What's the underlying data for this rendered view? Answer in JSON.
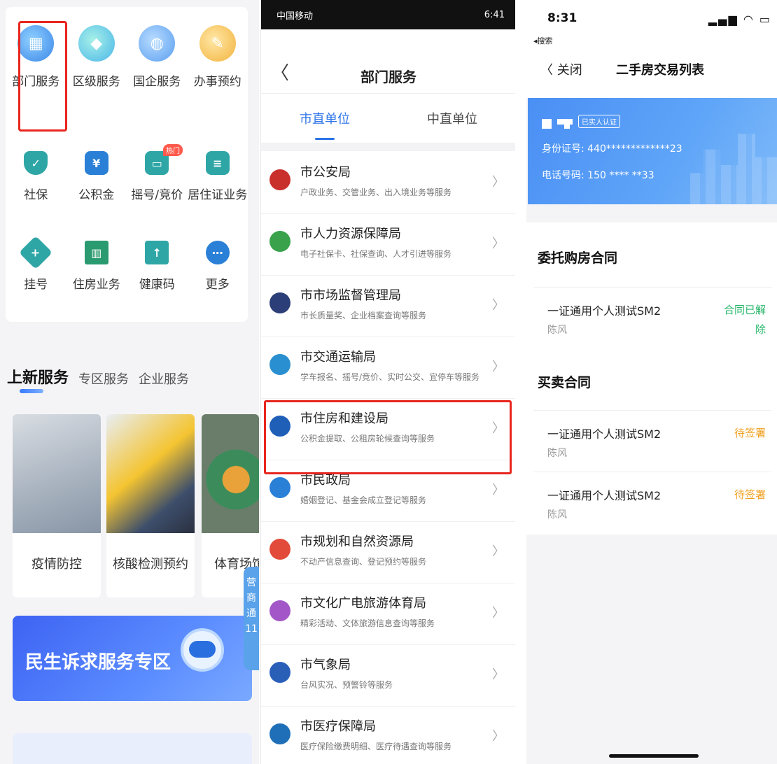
{
  "panel1": {
    "top_grid": [
      {
        "label": "部门服务",
        "icon": "department-icon",
        "color": "#3b86e8"
      },
      {
        "label": "区级服务",
        "icon": "district-icon",
        "color": "#4bb6e8"
      },
      {
        "label": "国企服务",
        "icon": "enterprise-icon",
        "color": "#5a9ef0"
      },
      {
        "label": "办事预约",
        "icon": "appointment-icon",
        "color": "#f2b33d"
      }
    ],
    "mid_grid": [
      {
        "label": "社保",
        "icon": "shield-icon",
        "color": "#2fa6a6"
      },
      {
        "label": "公积金",
        "icon": "house-yen-icon",
        "color": "#2a7fd6"
      },
      {
        "label": "摇号/竞价",
        "icon": "car-icon",
        "color": "#2fa6a6",
        "badge": "热门"
      },
      {
        "label": "居住证业务",
        "icon": "id-card-icon",
        "color": "#2fa6a6"
      }
    ],
    "low_grid": [
      {
        "label": "挂号",
        "icon": "plus-diamond-icon",
        "color": "#2fa6a6"
      },
      {
        "label": "住房业务",
        "icon": "building-icon",
        "color": "#2a9a70"
      },
      {
        "label": "健康码",
        "icon": "health-code-icon",
        "color": "#2fa6a6"
      },
      {
        "label": "更多",
        "icon": "more-icon",
        "color": "#2a7fd6"
      }
    ],
    "tabs": [
      "上新服务",
      "专区服务",
      "企业服务"
    ],
    "services": [
      "疫情防控",
      "核酸检测预约",
      "体育场馆预"
    ],
    "banner_text": "民生诉求服务专区",
    "float_text": "营商通11"
  },
  "panel2": {
    "status_left": "中国移动",
    "status_right": "6:41",
    "title": "部门服务",
    "seg_tabs": [
      "市直单位",
      "中直单位"
    ],
    "departments": [
      {
        "name": "市公安局",
        "desc": "户政业务、交管业务、出入境业务等服务",
        "color": "#c9302c",
        "icon": "police-badge-icon"
      },
      {
        "name": "市人力资源保障局",
        "desc": "电子社保卡、社保查询、人才引进等服务",
        "color": "#3aa24a",
        "icon": "hr-icon"
      },
      {
        "name": "市市场监督管理局",
        "desc": "市长质量奖、企业档案查询等服务",
        "color": "#2c3e78",
        "icon": "market-icon"
      },
      {
        "name": "市交通运输局",
        "desc": "学车报名、摇号/竞价、实时公交、宜停车等服务",
        "color": "#2a8fd0",
        "icon": "transport-icon"
      },
      {
        "name": "市住房和建设局",
        "desc": "公积金提取、公租房轮候查询等服务",
        "color": "#1f5fb8",
        "icon": "szjs-logo-icon"
      },
      {
        "name": "市民政局",
        "desc": "婚姻登记、基金会成立登记等服务",
        "color": "#2a7fd6",
        "icon": "civil-affairs-icon"
      },
      {
        "name": "市规划和自然资源局",
        "desc": "不动产信息查询、登记预约等服务",
        "color": "#e24a3a",
        "icon": "planning-icon"
      },
      {
        "name": "市文化广电旅游体育局",
        "desc": "精彩活动、文体旅游信息查询等服务",
        "color": "#a256c8",
        "icon": "culture-icon"
      },
      {
        "name": "市气象局",
        "desc": "台风实况、预警铃等服务",
        "color": "#2a5fb8",
        "icon": "weather-icon"
      },
      {
        "name": "市医疗保障局",
        "desc": "医疗保险缴费明细、医疗待遇查询等服务",
        "color": "#1f6fb8",
        "icon": "medical-icon"
      }
    ]
  },
  "panel3": {
    "time": "8:31",
    "sub": "◂搜索",
    "signal": "▂▄▆ ◠ ▭",
    "back_label": "〈  关闭",
    "title": "二手房交易列表",
    "verified": "已实人认证",
    "id_no": "身份证号: 440*************23",
    "phone": "电话号码: 150 **** **33",
    "sections": [
      {
        "title": "委托购房合同",
        "items": [
          {
            "name": "一证通用个人测试SM2",
            "person": "陈风",
            "status": "合同已解除",
            "color": "#27b66a"
          }
        ]
      },
      {
        "title": "买卖合同",
        "items": [
          {
            "name": "一证通用个人测试SM2",
            "person": "陈风",
            "status": "待签署",
            "color": "#f0a020"
          },
          {
            "name": "一证通用个人测试SM2",
            "person": "陈风",
            "status": "待签署",
            "color": "#f0a020"
          }
        ]
      }
    ]
  }
}
